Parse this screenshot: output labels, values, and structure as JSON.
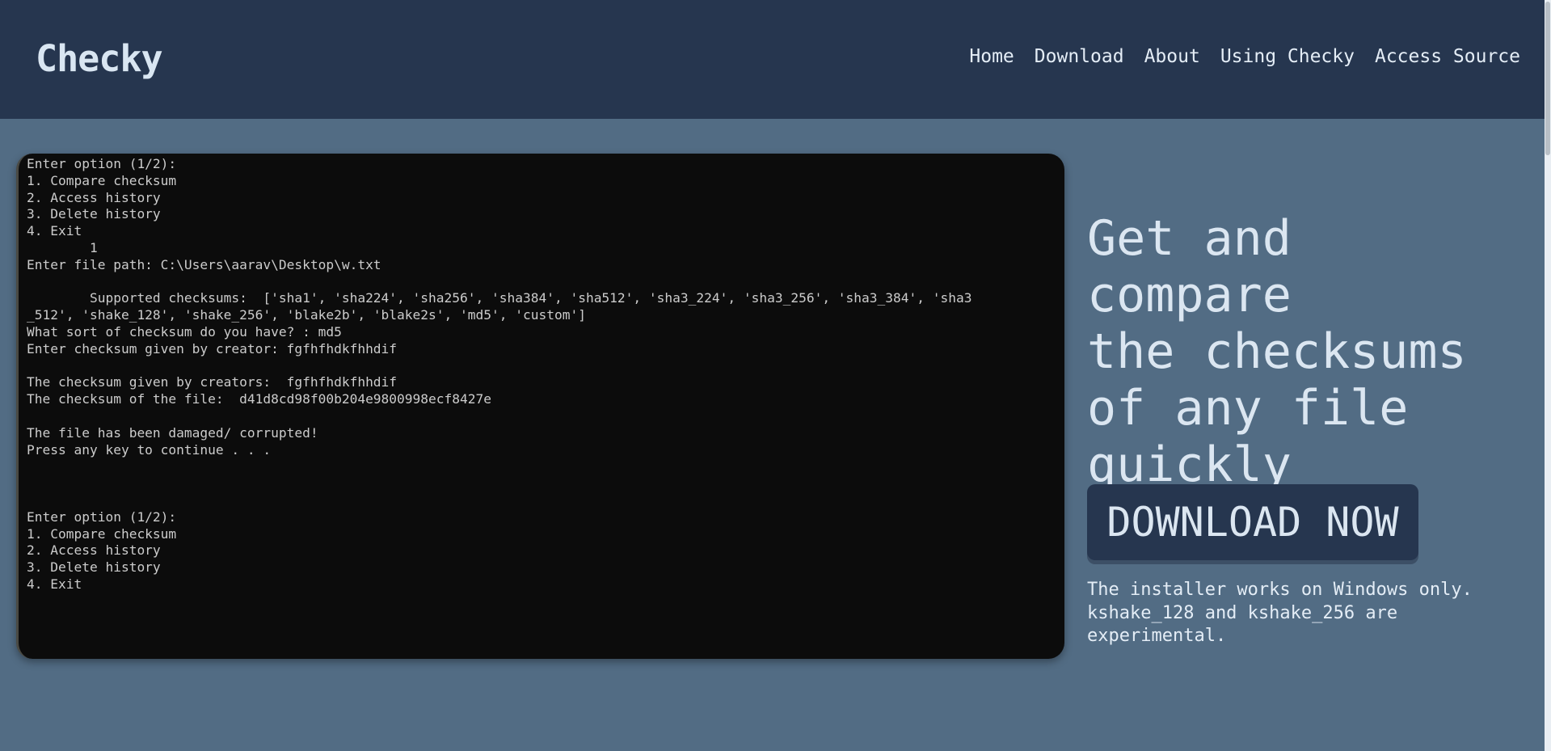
{
  "header": {
    "brand": "Checky",
    "nav": [
      "Home",
      "Download",
      "About",
      "Using Checky",
      "Access Source"
    ]
  },
  "terminal": {
    "lines": [
      "Enter option (1/2):",
      "1. Compare checksum",
      "2. Access history",
      "3. Delete history",
      "4. Exit",
      "        1",
      "Enter file path: C:\\Users\\aarav\\Desktop\\w.txt",
      "",
      "        Supported checksums:  ['sha1', 'sha224', 'sha256', 'sha384', 'sha512', 'sha3_224', 'sha3_256', 'sha3_384', 'sha3",
      "_512', 'shake_128', 'shake_256', 'blake2b', 'blake2s', 'md5', 'custom']",
      "What sort of checksum do you have? : md5",
      "Enter checksum given by creator: fgfhfhdkfhhdif",
      "",
      "The checksum given by creators:  fgfhfhdkfhhdif",
      "The checksum of the file:  d41d8cd98f00b204e9800998ecf8427e",
      "",
      "The file has been damaged/ corrupted!",
      "Press any key to continue . . .",
      "",
      "",
      "",
      "Enter option (1/2):",
      "1. Compare checksum",
      "2. Access history",
      "3. Delete history",
      "4. Exit"
    ]
  },
  "hero": {
    "title_lines": [
      "Get and compare",
      "the checksums",
      "of any file",
      "quickly"
    ]
  },
  "download": {
    "button_label": "DOWNLOAD NOW",
    "notes": [
      "The installer works on Windows only.",
      "kshake_128 and kshake_256 are",
      "experimental."
    ]
  },
  "colors": {
    "header_bg": "#26364f",
    "page_bg": "#526c84",
    "terminal_bg": "#0c0c0c",
    "text_light": "#dbe6f1"
  }
}
